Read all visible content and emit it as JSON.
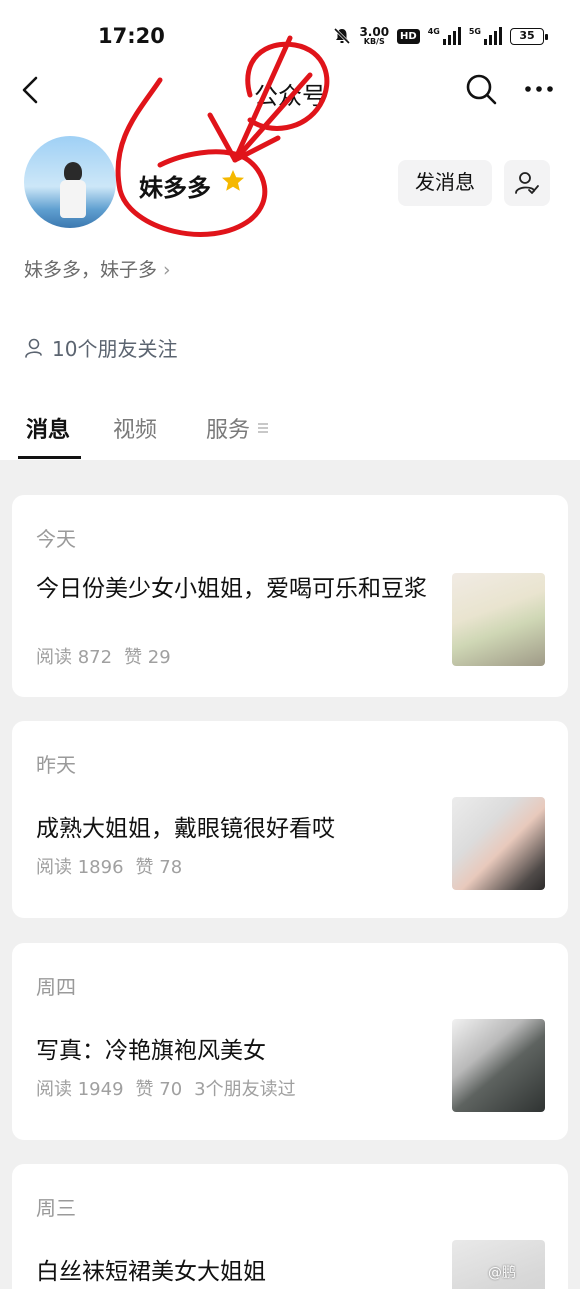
{
  "status_bar": {
    "time": "17:20",
    "net_speed_value": "3.00",
    "net_speed_unit": "KB/S",
    "hd_label": "HD",
    "sig1_label": "4G",
    "sig2_label": "5G",
    "battery": "35"
  },
  "nav": {
    "title": "公众号"
  },
  "profile": {
    "name": "妹多多",
    "description": "妹多多，妹子多",
    "send_message_label": "发消息",
    "friends_following": "10个朋友关注"
  },
  "tabs": [
    {
      "label": "消息",
      "active": true
    },
    {
      "label": "视频",
      "active": false
    },
    {
      "label": "服务",
      "active": false
    }
  ],
  "articles": [
    {
      "day": "今天",
      "title": "今日份美少女小姐姐，爱喝可乐和豆浆",
      "reads": "阅读 872",
      "likes": "赞 29",
      "extra": ""
    },
    {
      "day": "昨天",
      "title": "成熟大姐姐，戴眼镜很好看哎",
      "reads": "阅读 1896",
      "likes": "赞 78",
      "extra": ""
    },
    {
      "day": "周四",
      "title": "写真：冷艳旗袍风美女",
      "reads": "阅读 1949",
      "likes": "赞 70",
      "extra": "3个朋友读过"
    },
    {
      "day": "周三",
      "title": "白丝袜短裙美女大姐姐",
      "reads": "",
      "likes": "",
      "extra": ""
    }
  ],
  "watermark": "@鹏",
  "colors": {
    "annotation_red": "#e0141a",
    "star_yellow": "#f5b800",
    "feed_background": "#f0f0f0"
  },
  "icons": [
    "back-arrow-icon",
    "search-icon",
    "more-icon",
    "star-icon",
    "follow-user-icon",
    "friends-icon",
    "tab-menu-icon"
  ]
}
